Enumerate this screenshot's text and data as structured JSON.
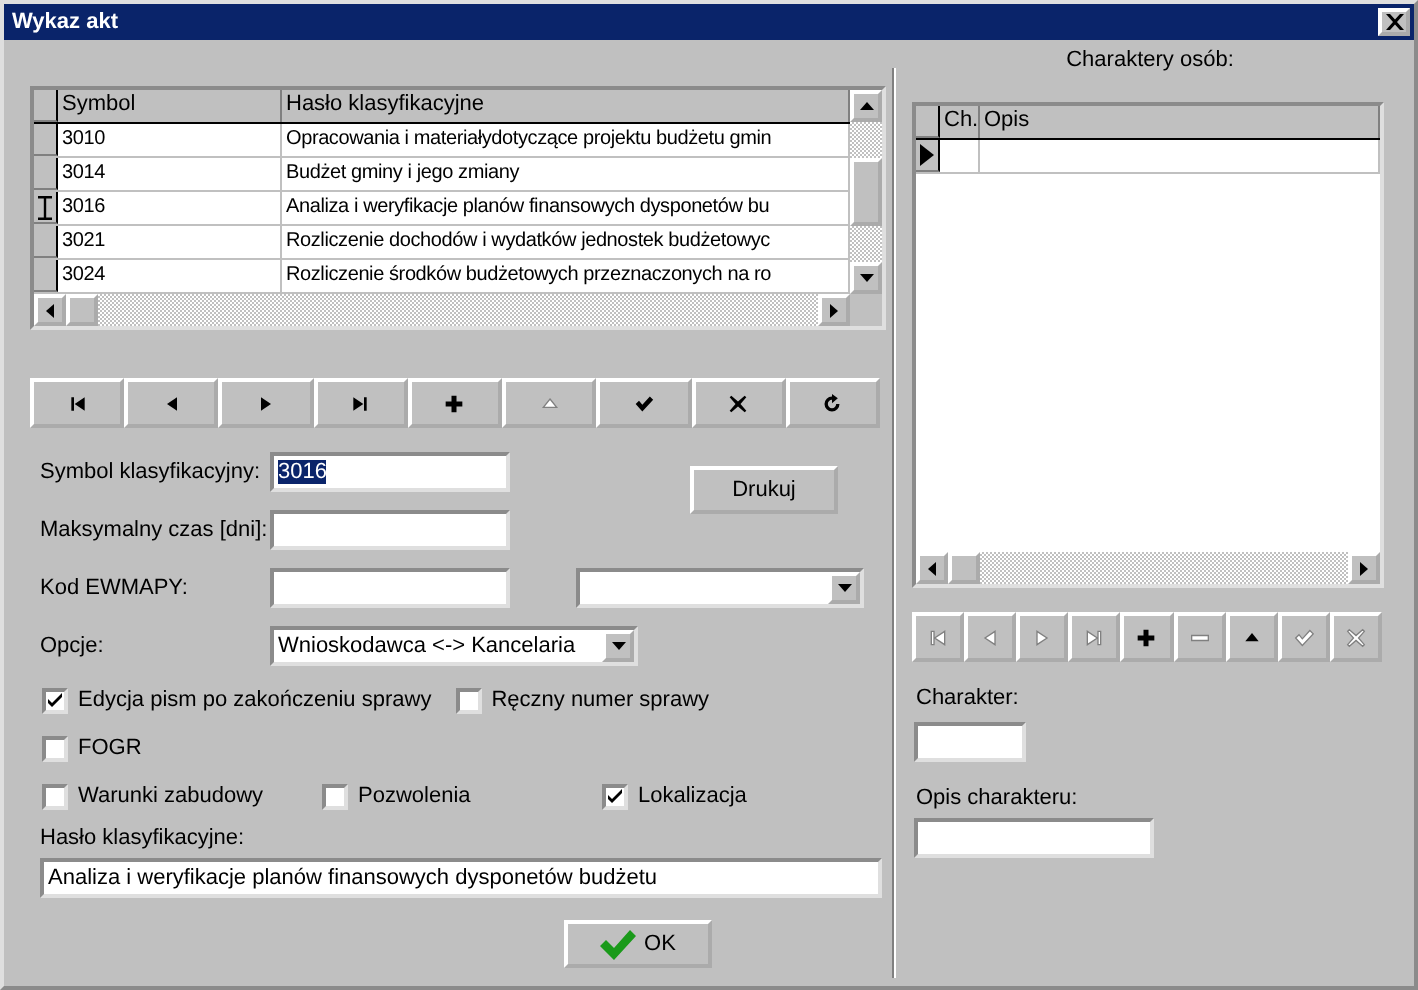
{
  "window": {
    "title": "Wykaz akt"
  },
  "table": {
    "editing": true,
    "columns": [
      "Symbol",
      "Hasło klasyfikacyjne"
    ],
    "rows": [
      {
        "symbol": "3010",
        "haslo": "Opracowania i materiałydotyczące projektu budżetu gmin",
        "selected": false
      },
      {
        "symbol": "3014",
        "haslo": "Budżet gminy i jego zmiany",
        "selected": false
      },
      {
        "symbol": "3016",
        "haslo": "Analiza i weryfikacje planów finansowych dysponetów bu",
        "selected": true
      },
      {
        "symbol": "3021",
        "haslo": "Rozliczenie dochodów i wydatków jednostek budżetowyc",
        "selected": false
      },
      {
        "symbol": "3024",
        "haslo": "Rozliczenie środków budżetowych przeznaczonych na ro",
        "selected": false
      }
    ]
  },
  "navigator": [
    {
      "kind": "first",
      "disabled": false
    },
    {
      "kind": "prior",
      "disabled": false
    },
    {
      "kind": "next",
      "disabled": false
    },
    {
      "kind": "last",
      "disabled": false
    },
    {
      "kind": "insert",
      "disabled": false
    },
    {
      "kind": "edit",
      "disabled": true
    },
    {
      "kind": "post",
      "disabled": false
    },
    {
      "kind": "cancel",
      "disabled": false
    },
    {
      "kind": "refresh",
      "disabled": false
    }
  ],
  "form": {
    "symbol": {
      "label": "Symbol klasyfikacyjny:",
      "value": "3016",
      "value_selected": true
    },
    "print_button": "Drukuj",
    "max_time": {
      "label": "Maksymalny czas [dni]:"
    },
    "ewmapy": {
      "label": "Kod EWMAPY:"
    },
    "options": {
      "label": "Opcje:",
      "value": "Wnioskodawca <-> Kancelaria"
    },
    "checkbox_rows": [
      [
        {
          "label": "Edycja pism po zakończeniu sprawy",
          "checked": true
        },
        {
          "label": "Ręczny numer sprawy",
          "checked": false
        }
      ],
      [
        {
          "label": "FOGR",
          "checked": false
        }
      ],
      [
        {
          "label": "Warunki zabudowy",
          "checked": false
        },
        {
          "label": "Pozwolenia",
          "checked": false
        },
        {
          "label": "Lokalizacja",
          "checked": true
        }
      ]
    ],
    "haslo": {
      "label": "Hasło klasyfikacyjne:",
      "value": "Analiza i weryfikacje planów finansowych dysponetów budżetu"
    }
  },
  "ok_button": "OK",
  "characters": {
    "title": "Charaktery osób:",
    "editing": false,
    "columns": [
      "Ch.",
      "Opis"
    ],
    "rows": [
      {
        "selected": true
      }
    ],
    "navigator": [
      {
        "kind": "first",
        "disabled": true
      },
      {
        "kind": "prior",
        "disabled": true
      },
      {
        "kind": "next",
        "disabled": true
      },
      {
        "kind": "last",
        "disabled": true
      },
      {
        "kind": "insert",
        "disabled": false
      },
      {
        "kind": "delete",
        "disabled": true
      },
      {
        "kind": "edit",
        "disabled": false
      },
      {
        "kind": "post",
        "disabled": true
      },
      {
        "kind": "cancel",
        "disabled": true
      }
    ],
    "charakter": {
      "label": "Charakter:"
    },
    "opis": {
      "label": "Opis charakteru:"
    }
  }
}
